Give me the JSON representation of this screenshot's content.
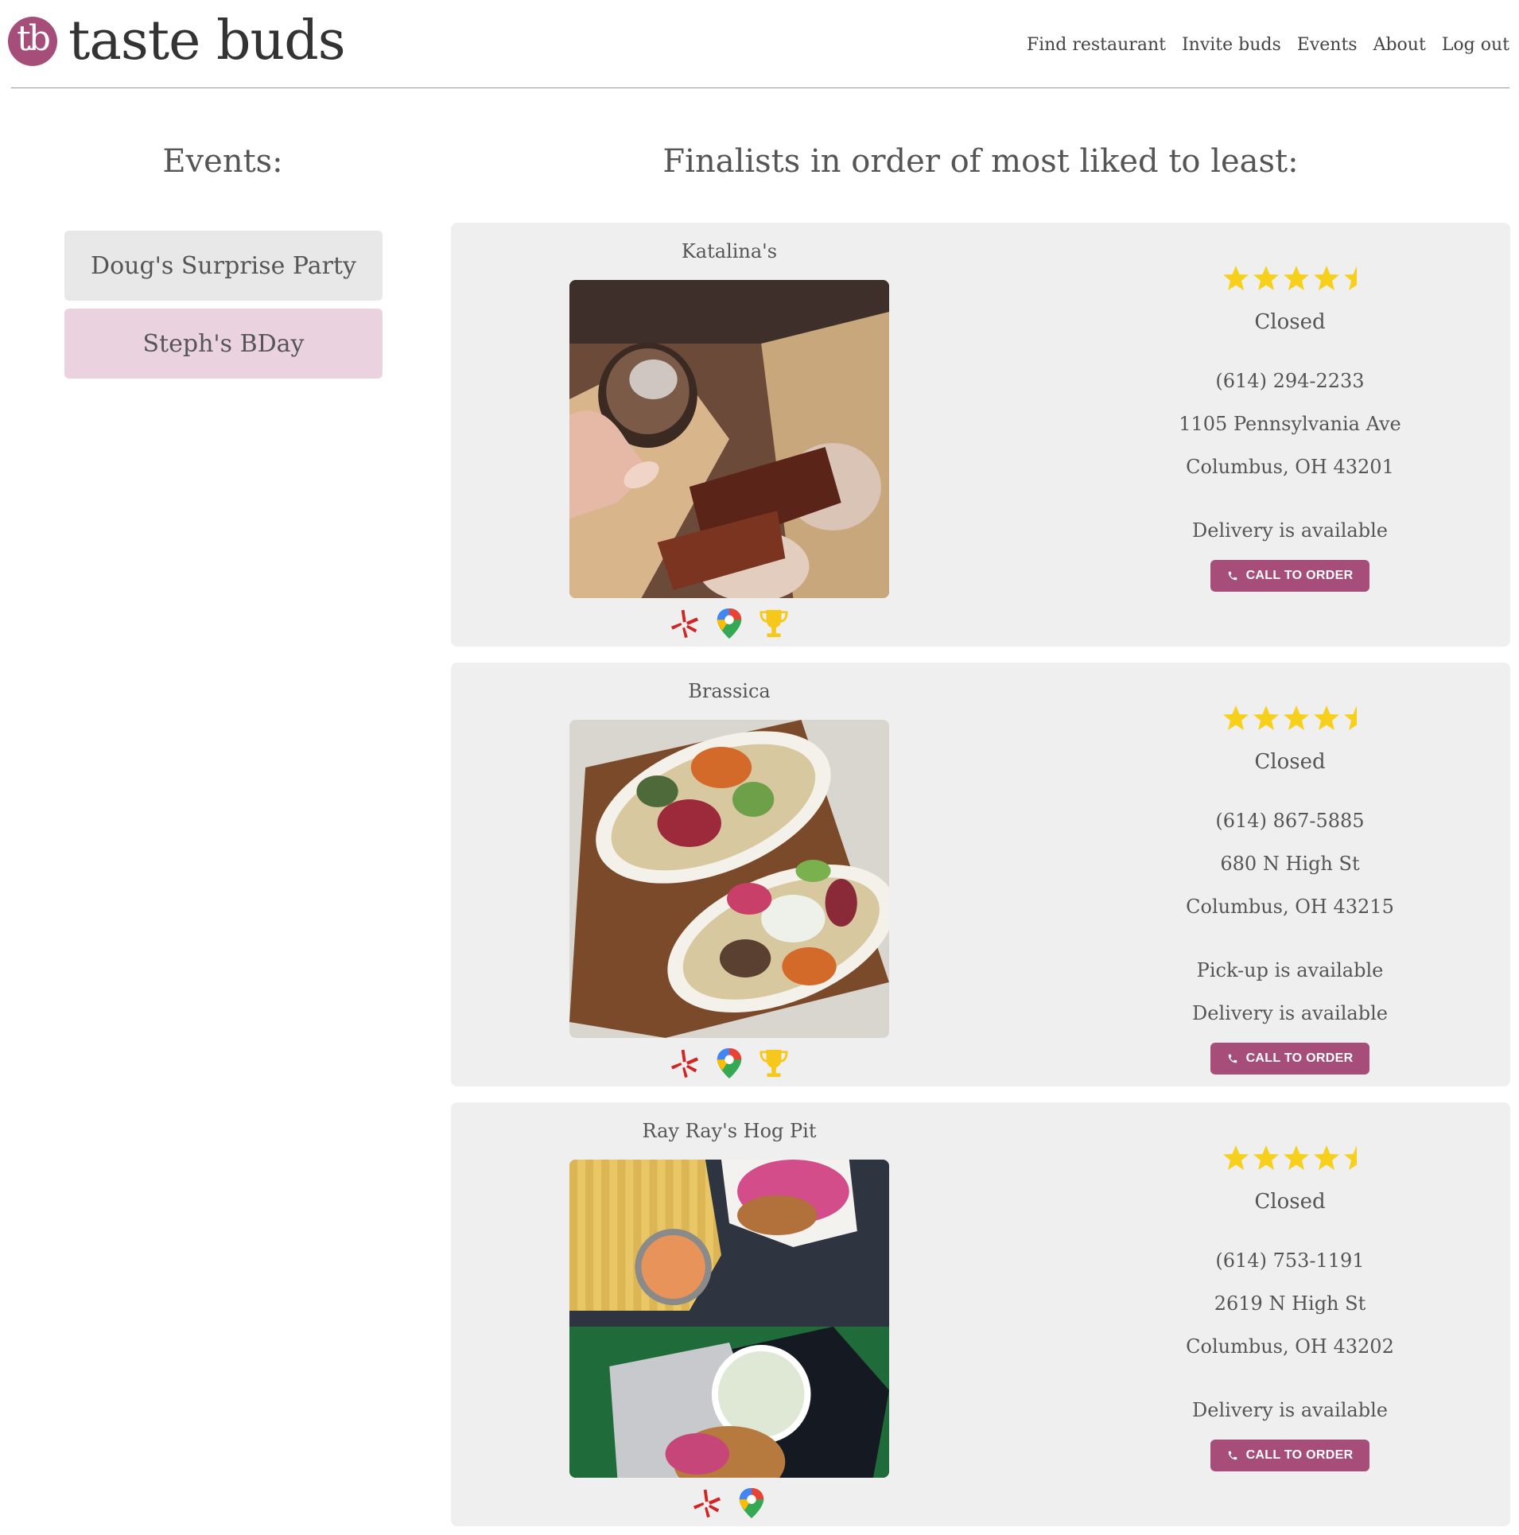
{
  "app": {
    "logo_mark": "tb",
    "title": "taste buds"
  },
  "nav": [
    {
      "label": "Find restaurant"
    },
    {
      "label": "Invite buds"
    },
    {
      "label": "Events"
    },
    {
      "label": "About"
    },
    {
      "label": "Log out"
    }
  ],
  "events": {
    "heading": "Events:",
    "items": [
      {
        "label": "Doug's Surprise Party",
        "selected": false
      },
      {
        "label": "Steph's BDay",
        "selected": true
      }
    ]
  },
  "finalists": {
    "heading": "Finalists in order of most liked to least:",
    "restaurants": [
      {
        "name": "Katalina's",
        "rating": 4.5,
        "status": "Closed",
        "phone": "(614) 294-2233",
        "address_line1": "1105 Pennsylvania Ave",
        "address_line2": "Columbus, OH 43201",
        "services": [
          "Delivery is available"
        ],
        "call_label": "CALL TO ORDER",
        "links": [
          "yelp-icon",
          "google-maps-icon",
          "trophy-icon"
        ]
      },
      {
        "name": "Brassica",
        "rating": 4.5,
        "status": "Closed",
        "phone": "(614) 867-5885",
        "address_line1": "680 N High St",
        "address_line2": "Columbus, OH 43215",
        "services": [
          "Pick-up is available",
          "Delivery is available"
        ],
        "call_label": "CALL TO ORDER",
        "links": [
          "yelp-icon",
          "google-maps-icon",
          "trophy-icon"
        ]
      },
      {
        "name": "Ray Ray's Hog Pit",
        "rating": 4.5,
        "status": "Closed",
        "phone": "(614) 753-1191",
        "address_line1": "2619 N High St",
        "address_line2": "Columbus, OH 43202",
        "services": [
          "Delivery is available"
        ],
        "call_label": "CALL TO ORDER",
        "links": [
          "yelp-icon",
          "google-maps-icon"
        ]
      }
    ]
  },
  "colors": {
    "brand": "#a64d79",
    "star": "#f7d01c",
    "card_bg": "#efefef",
    "selected_event_bg": "#ead3de"
  }
}
